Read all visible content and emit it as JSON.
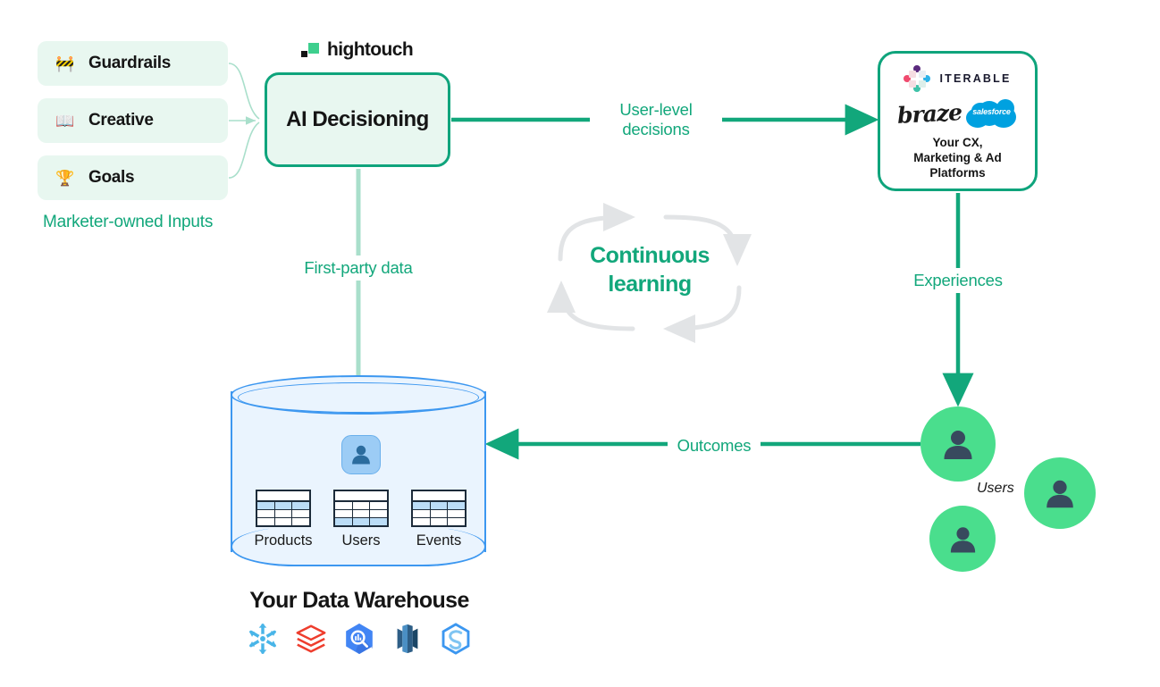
{
  "brand": {
    "name": "hightouch",
    "accent_green": "#12A77B",
    "box_green": "#0FA47C",
    "light_green_bg": "#E8F7F0",
    "user_green": "#4ADE8D",
    "warehouse_blue": "#3C97F0",
    "warehouse_fill": "#EAF4FE",
    "navy": "#384A5E"
  },
  "inputs": {
    "caption": "Marketer-owned Inputs",
    "cards": [
      {
        "icon": "barrier-icon",
        "emoji": "🚧",
        "label": "Guardrails"
      },
      {
        "icon": "book-icon",
        "emoji": "📖",
        "label": "Creative"
      },
      {
        "icon": "trophy-icon",
        "emoji": "🏆",
        "label": "Goals"
      }
    ]
  },
  "ai_box": {
    "title": "AI Decisioning"
  },
  "platforms": {
    "caption_line1": "Your CX,",
    "caption_line2": "Marketing & Ad",
    "caption_line3": "Platforms",
    "logos": [
      {
        "name": "iterable-logo",
        "wordmark": "ITERABLE"
      },
      {
        "name": "braze-logo",
        "wordmark": "braze"
      },
      {
        "name": "salesforce-logo",
        "wordmark": "salesforce"
      }
    ]
  },
  "loop": {
    "line1": "Continuous",
    "line2": "learning"
  },
  "edges": {
    "user_level_decisions": "User-level\ndecisions",
    "user_level_line1": "User-level",
    "user_level_line2": "decisions",
    "first_party_data": "First-party data",
    "experiences": "Experiences",
    "outcomes": "Outcomes"
  },
  "users_cluster": {
    "label": "Users",
    "count": 3
  },
  "warehouse": {
    "title": "Your Data Warehouse",
    "tables": [
      {
        "name": "products-table",
        "label": "Products"
      },
      {
        "name": "users-table",
        "label": "Users"
      },
      {
        "name": "events-table",
        "label": "Events"
      }
    ],
    "center_entity": "user-entity-icon",
    "vendor_logos": [
      {
        "name": "snowflake-logo",
        "color": "#49B5E8"
      },
      {
        "name": "databricks-logo",
        "color": "#EE3D2D"
      },
      {
        "name": "bigquery-logo",
        "color": "#4285F4"
      },
      {
        "name": "redshift-logo",
        "color": "#2E5E86"
      },
      {
        "name": "synapse-logo",
        "color": "#3C97F0"
      }
    ]
  }
}
